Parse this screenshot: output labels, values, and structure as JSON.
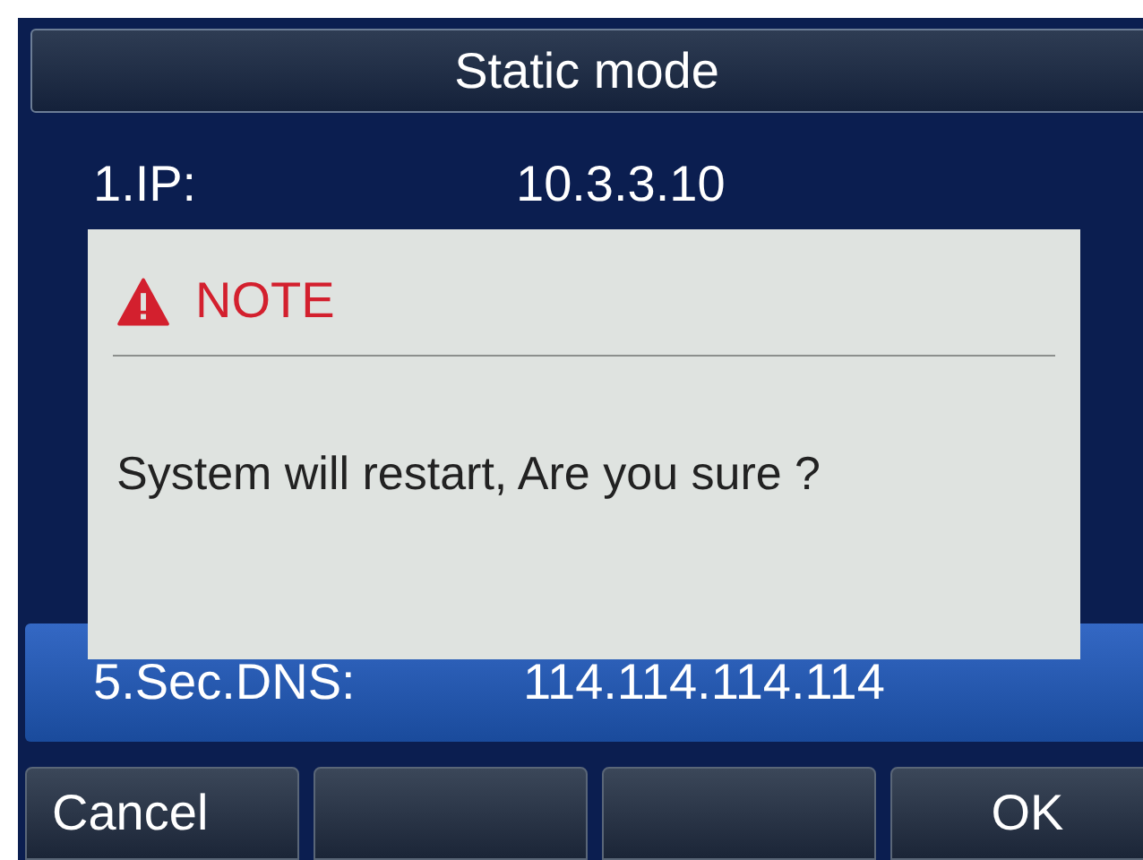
{
  "header": {
    "title": "Static mode"
  },
  "rows": [
    {
      "label": "1.IP:",
      "value": "10.3.3.10",
      "selected": false
    },
    {
      "label": "5.Sec.DNS:",
      "value": "114.114.114.114",
      "selected": true
    }
  ],
  "dialog": {
    "title": "NOTE",
    "message": "System will restart, Are you sure ?"
  },
  "softkeys": [
    {
      "kind": "label",
      "label": "Cancel"
    },
    {
      "kind": "blank"
    },
    {
      "kind": "blank"
    },
    {
      "kind": "label",
      "label": "OK"
    }
  ]
}
